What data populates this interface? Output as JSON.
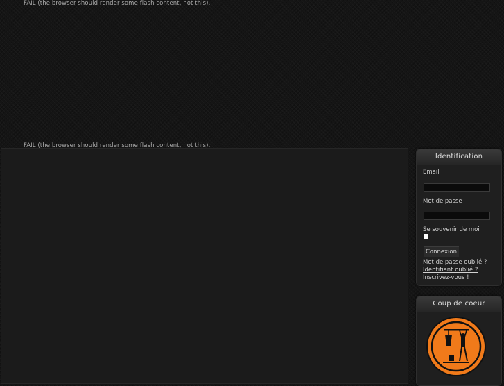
{
  "flash": {
    "fail_top": "FAIL (the browser should render some flash content, not this).",
    "fail_bottom": "FAIL (the browser should render some flash content, not this)."
  },
  "login": {
    "title": "Identification",
    "email_label": "Email",
    "email_value": "",
    "password_label": "Mot de passe",
    "password_value": "",
    "remember_label": "Se souvenir de moi",
    "remember_checked": false,
    "submit_label": "Connexion",
    "forgot_password": "Mot de passe oublié ?",
    "forgot_username": "Identifiant oublié ?",
    "register": "Inscrivez-vous !"
  },
  "featured": {
    "title": "Coup de coeur",
    "logo_icon": "orange-circle-figure-logo"
  },
  "colors": {
    "background": "#151515",
    "panel": "#1f1f1f",
    "logo_orange": "#f07a1a",
    "text": "#d2d2d2"
  }
}
